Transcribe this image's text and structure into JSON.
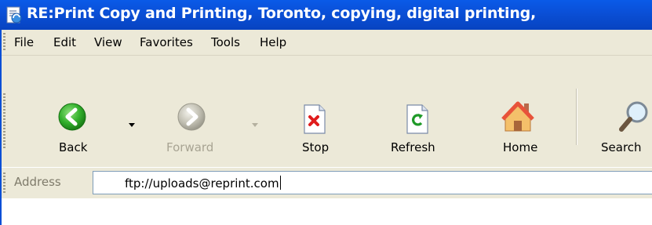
{
  "window": {
    "title": "RE:Print Copy and Printing, Toronto, copying, digital printing,"
  },
  "menubar": {
    "items": [
      "File",
      "Edit",
      "View",
      "Favorites",
      "Tools",
      "Help"
    ]
  },
  "toolbar": {
    "back_label": "Back",
    "forward_label": "Forward",
    "stop_label": "Stop",
    "refresh_label": "Refresh",
    "home_label": "Home",
    "search_label": "Search"
  },
  "address": {
    "label": "Address",
    "value": "ftp://uploads@reprint.com"
  },
  "colors": {
    "titlebar": "#0a4fd6",
    "chrome": "#ece9d8",
    "back_green": "#2fa52a",
    "disabled_gray": "#a8a493"
  }
}
